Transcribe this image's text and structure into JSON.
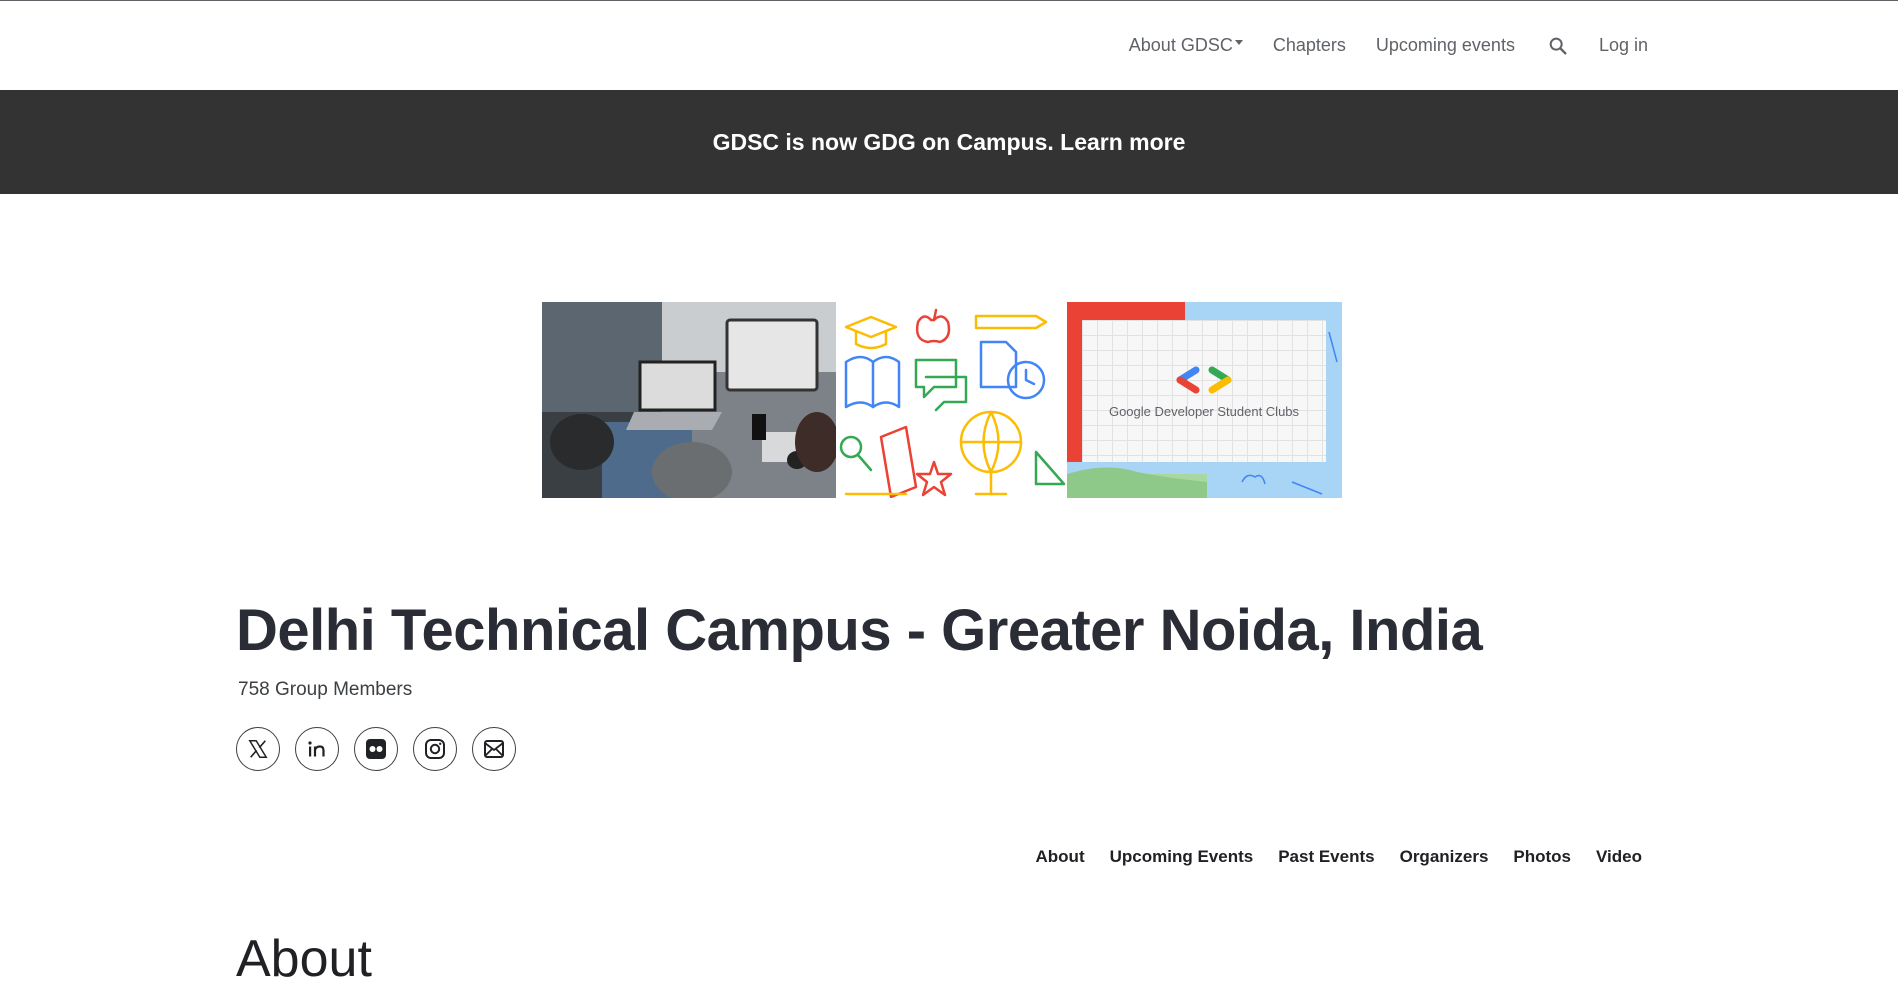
{
  "topnav": {
    "items": [
      {
        "label": "About GDSC",
        "dropdown": true
      },
      {
        "label": "Chapters"
      },
      {
        "label": "Upcoming events"
      }
    ],
    "search_icon": "search-icon",
    "login": "Log in"
  },
  "banner": {
    "text": "GDSC is now GDG on Campus. Learn more"
  },
  "hero": {
    "logo_text": "Google Developer Student Clubs"
  },
  "chapter": {
    "title": "Delhi Technical Campus - Greater Noida, India",
    "members": "758 Group Members"
  },
  "socials": [
    "x-icon",
    "linkedin-icon",
    "flickr-icon",
    "instagram-icon",
    "email-icon"
  ],
  "subnav": [
    "About",
    "Upcoming Events",
    "Past Events",
    "Organizers",
    "Photos",
    "Video"
  ],
  "section": {
    "heading": "About"
  },
  "colors": {
    "banner_bg": "#333333",
    "logo_blue": "#4285f4",
    "logo_red": "#ea4335",
    "logo_green": "#34a853",
    "logo_yellow": "#fbbc04"
  }
}
